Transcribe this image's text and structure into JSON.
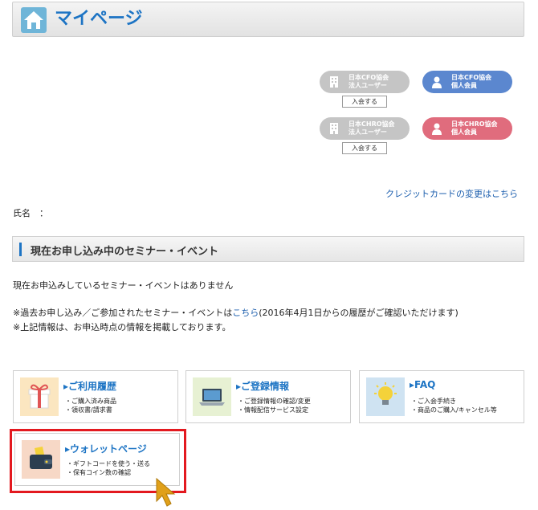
{
  "header": {
    "title": "マイページ",
    "icon": "home-icon"
  },
  "memberships": [
    {
      "line1": "日本CFO協会",
      "line2": "法人ユーザー",
      "style": "grey",
      "icon": "building-icon",
      "join": "入会する"
    },
    {
      "line1": "日本CFO協会",
      "line2": "個人会員",
      "style": "blue",
      "icon": "person-icon"
    },
    {
      "line1": "日本CHRO協会",
      "line2": "法人ユーザー",
      "style": "grey",
      "icon": "building-icon",
      "join": "入会する"
    },
    {
      "line1": "日本CHRO協会",
      "line2": "個人会員",
      "style": "red",
      "icon": "person-icon"
    }
  ],
  "credit_link": "クレジットカードの変更はこちら",
  "name_label": "氏名　：",
  "section": {
    "title": "現在お申し込み中のセミナー・イベント",
    "empty": "現在お申込みしているセミナー・イベントはありません",
    "note1_prefix": "※過去お申し込み／ご参加されたセミナー・イベントは",
    "note1_link": "こちら",
    "note1_suffix": "(2016年4月1日からの履歴がご確認いただけます)",
    "note2": "※上記情報は、お申込時点の情報を掲載しております。"
  },
  "cards": [
    {
      "title": "▸ご利用履歴",
      "line1": "・ご購入済み商品",
      "line2": "・領収書/請求書",
      "icon": "gift-icon",
      "thumb": "#fbe6c0"
    },
    {
      "title": "▸ご登録情報",
      "line1": "・ご登録情報の確認/変更",
      "line2": "・情報配信サービス設定",
      "icon": "laptop-icon",
      "thumb": "#e7f1d3"
    },
    {
      "title": "▸FAQ",
      "line1": "・ご入会手続き",
      "line2": "・商品のご購入/キャンセル等",
      "icon": "lightbulb-icon",
      "thumb": "#cfe3f2"
    },
    {
      "title": "▸ウォレットページ",
      "line1": "・ギフトコードを使う・送る",
      "line2": "・保有コイン数の確認",
      "icon": "wallet-icon",
      "thumb": "#f7d8c6"
    }
  ],
  "colors": {
    "accent": "#1d74c4",
    "highlight": "#e3191f",
    "cursor": "#e0a01a"
  }
}
